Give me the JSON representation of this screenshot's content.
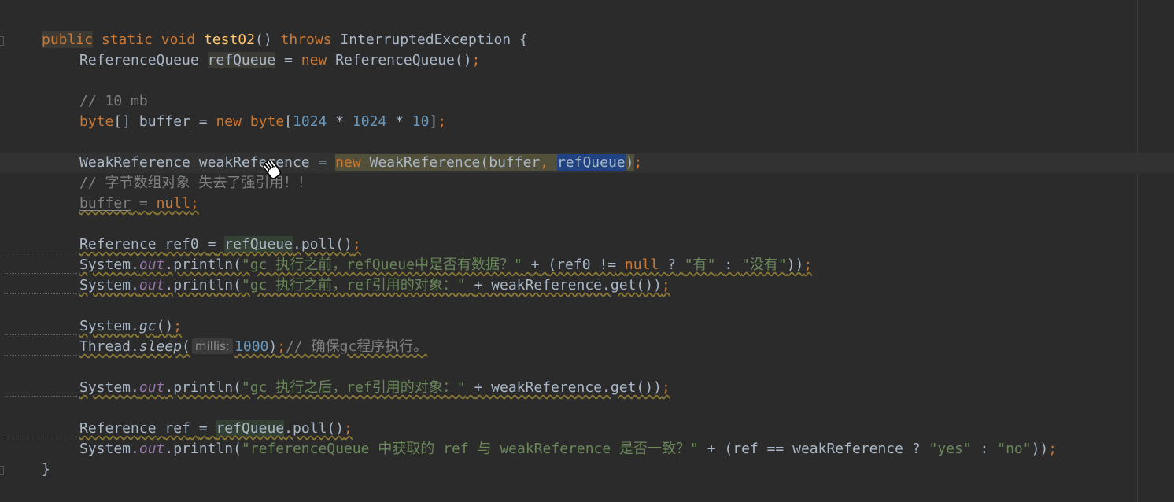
{
  "code": {
    "l1": {
      "kw_public": "public",
      "kw_static": "static",
      "kw_void": "void",
      "method_name": "test02",
      "parens": "()",
      "kw_throws": "throws",
      "exception": "InterruptedException",
      "brace": "{"
    },
    "l2": {
      "type": "ReferenceQueue",
      "var": "refQueue",
      "eq": "=",
      "kw_new": "new",
      "ctor": "ReferenceQueue()",
      "semi": ";"
    },
    "l3": {
      "comment": "// 10 mb"
    },
    "l4": {
      "type": "byte",
      "brackets": "[]",
      "var": "buffer",
      "eq": "=",
      "kw_new": "new",
      "type2": "byte",
      "open": "[",
      "n1": "1024",
      "star1": "*",
      "n2": "1024",
      "star2": "*",
      "n3": "10",
      "close": "]",
      "semi": ";"
    },
    "l5": {
      "type": "WeakReference",
      "var": "weakReference",
      "eq": "=",
      "kw_new": "new",
      "ctor": "WeakReference(",
      "arg1": "buffer",
      "comma": ",",
      "arg2": "refQueue",
      "close": ")",
      "semi": ";"
    },
    "l6": {
      "comment": "// 字节数组对象 失去了强引用！！"
    },
    "l7": {
      "var": "buffer",
      "eq": "=",
      "kw_null": "null",
      "semi": ";"
    },
    "l8": {
      "type": "Reference",
      "var": "ref0",
      "eq": "=",
      "queue": "refQueue",
      "call": ".poll()",
      "semi": ";"
    },
    "l9": {
      "cls": "System.",
      "field": "out",
      "call": ".println(",
      "str1": "\"gc 执行之前，refQueue中是否有数据？\"",
      "plus": "+",
      "open": "(ref0 !=",
      "kw_null": "null",
      "q": "?",
      "str2": "\"有\"",
      "colon": ":",
      "str3": "\"没有\"",
      "close": "))",
      "semi": ";"
    },
    "l10": {
      "cls": "System.",
      "field": "out",
      "call": ".println(",
      "str1": "\"gc 执行之前，ref引用的对象：\"",
      "rest": "+ weakReference.get())",
      "semi": ";"
    },
    "l11": {
      "cls": "System.",
      "method": "gc",
      "call": "()",
      "semi": ";"
    },
    "l12": {
      "cls": "Thread.",
      "method": "sleep",
      "open": "(",
      "hint": "millis:",
      "num": "1000",
      "close": ")",
      "semi": ";",
      "comment": "// 确保gc程序执行。"
    },
    "l13": {
      "cls": "System.",
      "field": "out",
      "call": ".println(",
      "str1": "\"gc 执行之后，ref引用的对象：\"",
      "rest": "+ weakReference.get())",
      "semi": ";"
    },
    "l14": {
      "type": "Reference",
      "var": "ref",
      "eq": "=",
      "queue": "refQueue",
      "call": ".poll()",
      "semi": ";"
    },
    "l15": {
      "cls": "System.",
      "field": "out",
      "call": ".println(",
      "str1": "\"referenceQueue 中获取的 ref 与 weakReference 是否一致？\"",
      "mid": "+ (ref == weakReference ?",
      "str2": "\"yes\"",
      "colon": ":",
      "str3": "\"no\"",
      "close": "))",
      "semi": ";"
    },
    "l16": {
      "brace": "}"
    }
  },
  "colors": {
    "background": "#2b2b2b",
    "keyword": "#cc7832",
    "function": "#ffc66d",
    "number": "#6897bb",
    "string": "#6a8759",
    "comment": "#808080",
    "static_field": "#9876aa",
    "selection": "#214283"
  },
  "icons": {
    "cursor": "hand-grab-cursor-icon",
    "fold": "fold-marker-icon"
  }
}
